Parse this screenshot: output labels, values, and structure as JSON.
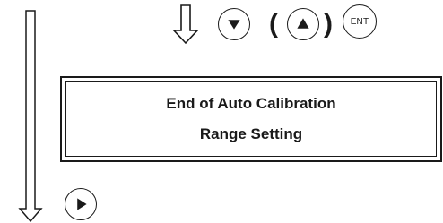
{
  "display": {
    "line1": "End of Auto Calibration",
    "line2": "Range Setting"
  },
  "keys": {
    "ent_label": "ENT",
    "open_paren": "(",
    "close_paren": ")",
    "down": "down-triangle-icon",
    "up": "up-triangle-icon",
    "right": "right-triangle-icon"
  },
  "colors": {
    "ink": "#1a1a1a",
    "arrow_fill": "#ffffff"
  }
}
